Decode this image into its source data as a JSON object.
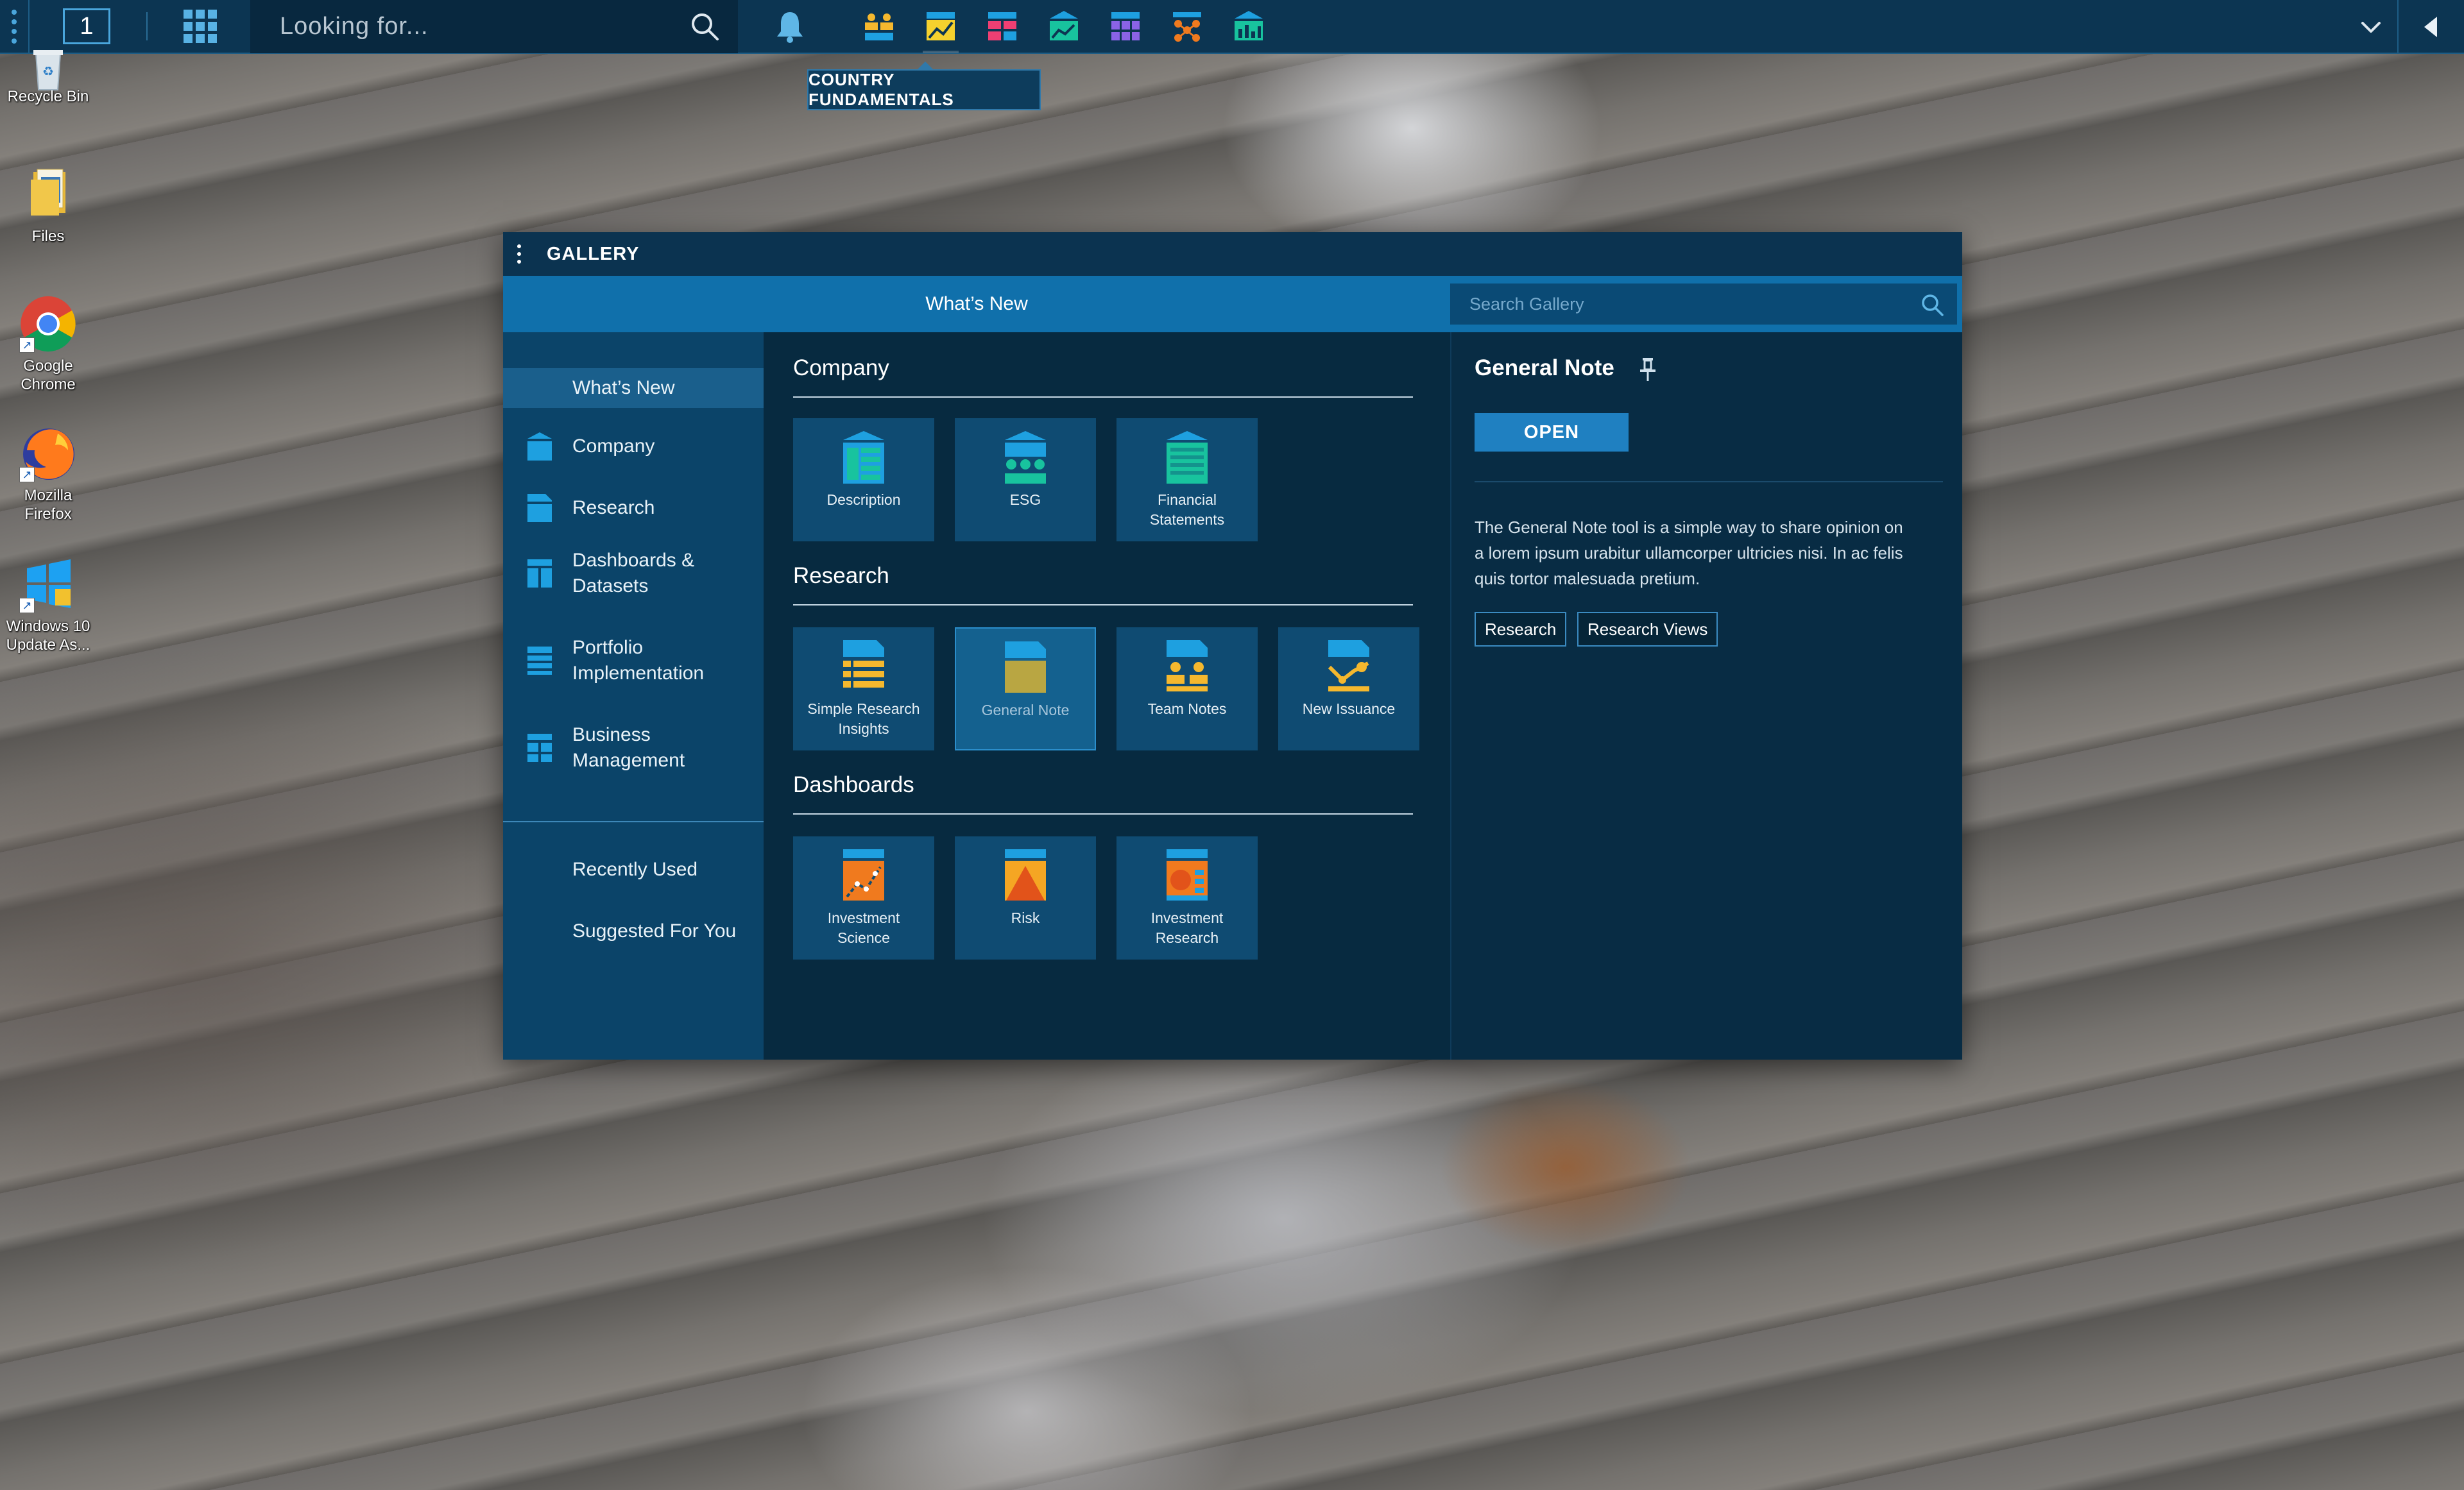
{
  "taskbar": {
    "workspace_number": "1",
    "search_placeholder": "Looking for...",
    "tooltip": "COUNTRY FUNDAMENTALS",
    "launchers": [
      "team-launcher-icon",
      "country-fundamentals-icon",
      "dashboard-launcher-icon",
      "chart-launcher-icon",
      "grid-launcher-icon",
      "network-launcher-icon",
      "bar-chart-launcher-icon"
    ]
  },
  "desktop": {
    "icons": [
      {
        "label": "Recycle Bin"
      },
      {
        "label": "Files"
      },
      {
        "label": "Google Chrome"
      },
      {
        "label": "Mozilla Firefox"
      },
      {
        "label": "Windows 10 Update As..."
      }
    ]
  },
  "gallery": {
    "title": "GALLERY",
    "header_title": "What’s New",
    "search_placeholder": "Search Gallery",
    "sidebar": {
      "items": [
        {
          "label": "What’s New"
        },
        {
          "label": "Company"
        },
        {
          "label": "Research"
        },
        {
          "label": "Dashboards & Datasets"
        },
        {
          "label": "Portfolio Implementation"
        },
        {
          "label": "Business Management"
        },
        {
          "label": "Recently Used"
        },
        {
          "label": "Suggested For You"
        }
      ]
    },
    "sections": [
      {
        "title": "Company",
        "tiles": [
          {
            "label": "Description"
          },
          {
            "label": "ESG"
          },
          {
            "label": "Financial Statements"
          }
        ]
      },
      {
        "title": "Research",
        "tiles": [
          {
            "label": "Simple Research Insights"
          },
          {
            "label": "General Note"
          },
          {
            "label": "Team Notes"
          },
          {
            "label": "New Issuance"
          }
        ]
      },
      {
        "title": "Dashboards",
        "tiles": [
          {
            "label": "Investment Science"
          },
          {
            "label": "Risk"
          },
          {
            "label": "Investment Research"
          }
        ]
      }
    ],
    "detail": {
      "title": "General Note",
      "open_label": "OPEN",
      "description": "The General Note tool is a simple way to share opinion on a lorem ipsum urabitur ullamcorper ultricies nisi. In ac felis quis tortor malesuada pretium.",
      "tags": [
        "Research",
        "Research Views"
      ]
    }
  },
  "colors": {
    "taskbar": "#0c3552",
    "accent_blue": "#1070ab",
    "sidebar": "#0b4469",
    "tile": "#0f4b72",
    "open_button": "#1f80c1"
  }
}
